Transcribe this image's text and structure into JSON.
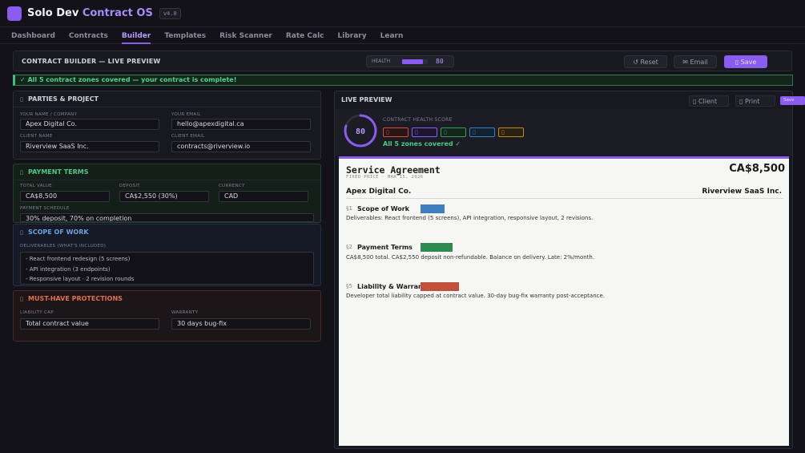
{
  "app": {
    "brand_prefix": "Solo Dev",
    "brand_accent": "Contract OS",
    "version": "v4.0"
  },
  "nav": {
    "tabs": [
      "Dashboard",
      "Contracts",
      "Builder",
      "Templates",
      "Risk Scanner",
      "Rate Calc",
      "Library",
      "Learn"
    ],
    "active": "Builder"
  },
  "builder": {
    "title": "CONTRACT BUILDER — LIVE PREVIEW",
    "health_label": "HEALTH",
    "health_value": 80,
    "reset_label": "↺ Reset",
    "email_label": "✉ Email",
    "save_label": "▯ Save"
  },
  "banner": {
    "text": "✓  All 5 contract zones covered — your contract is complete!"
  },
  "parties": {
    "header": "PARTIES & PROJECT",
    "your_name_label": "YOUR NAME / COMPANY",
    "your_name": "Apex Digital Co.",
    "your_email_label": "YOUR EMAIL",
    "your_email": "hello@apexdigital.ca",
    "client_name_label": "CLIENT NAME",
    "client_name": "Riverview SaaS Inc.",
    "client_email_label": "CLIENT EMAIL",
    "client_email": "contracts@riverview.io"
  },
  "payment": {
    "header": "PAYMENT TERMS",
    "total_label": "TOTAL VALUE",
    "total": "CA$8,500",
    "deposit_label": "DEPOSIT",
    "deposit": "CA$2,550 (30%)",
    "currency_label": "CURRENCY",
    "currency": "CAD",
    "schedule_label": "PAYMENT SCHEDULE",
    "schedule": "30% deposit, 70% on completion"
  },
  "scope": {
    "header": "SCOPE OF WORK",
    "deliverables_label": "DELIVERABLES (WHAT'S INCLUDED)",
    "lines": [
      "- React frontend redesign (5 screens)",
      "- API integration (3 endpoints)",
      "- Responsive layout  ·  2 revision rounds"
    ]
  },
  "protections": {
    "header": "MUST-HAVE PROTECTIONS",
    "liability_label": "LIABILITY CAP",
    "liability": "Total contract value",
    "warranty_label": "WARRANTY",
    "warranty": "30 days bug-fix"
  },
  "preview": {
    "header": "LIVE PREVIEW",
    "client_btn": "▯ Client",
    "print_btn": "▯ Print",
    "score": 80,
    "score_label": "CONTRACT HEALTH SCORE",
    "covered_text": "All 5 zones covered  ✓",
    "chips": [
      {
        "icon": "▯",
        "color": "#d05040",
        "bg": "#2a1414"
      },
      {
        "icon": "▯",
        "color": "#8a5cf0",
        "bg": "#1e1630"
      },
      {
        "icon": "▯",
        "color": "#3a9a60",
        "bg": "#12261c"
      },
      {
        "icon": "▯",
        "color": "#3a80c0",
        "bg": "#132030"
      },
      {
        "icon": "▯",
        "color": "#c08a20",
        "bg": "#2a2010"
      }
    ],
    "scroll_tag": "Save"
  },
  "document": {
    "title": "Service Agreement",
    "subtitle": "FIXED PRICE · MAR 15, 2026",
    "price": "CA$8,500",
    "party_left": "Apex Digital Co.",
    "party_right": "Riverview SaaS Inc.",
    "sections": [
      {
        "num": "§1",
        "title": "Scope of Work",
        "body": "Deliverables: React frontend (5 screens), API integration, responsive layout, 2 revisions.",
        "highlight": "#3f7fc0"
      },
      {
        "num": "§2",
        "title": "Payment Terms",
        "body": "CA$8,500 total. CA$2,550 deposit non-refundable. Balance on delivery. Late: 2%/month.",
        "highlight": "#2e8a50"
      },
      {
        "num": "§5",
        "title": "Liability & Warranty",
        "body": "Developer total liability capped at contract value. 30-day bug-fix warranty post-acceptance.",
        "highlight": "#c0503a"
      }
    ]
  }
}
